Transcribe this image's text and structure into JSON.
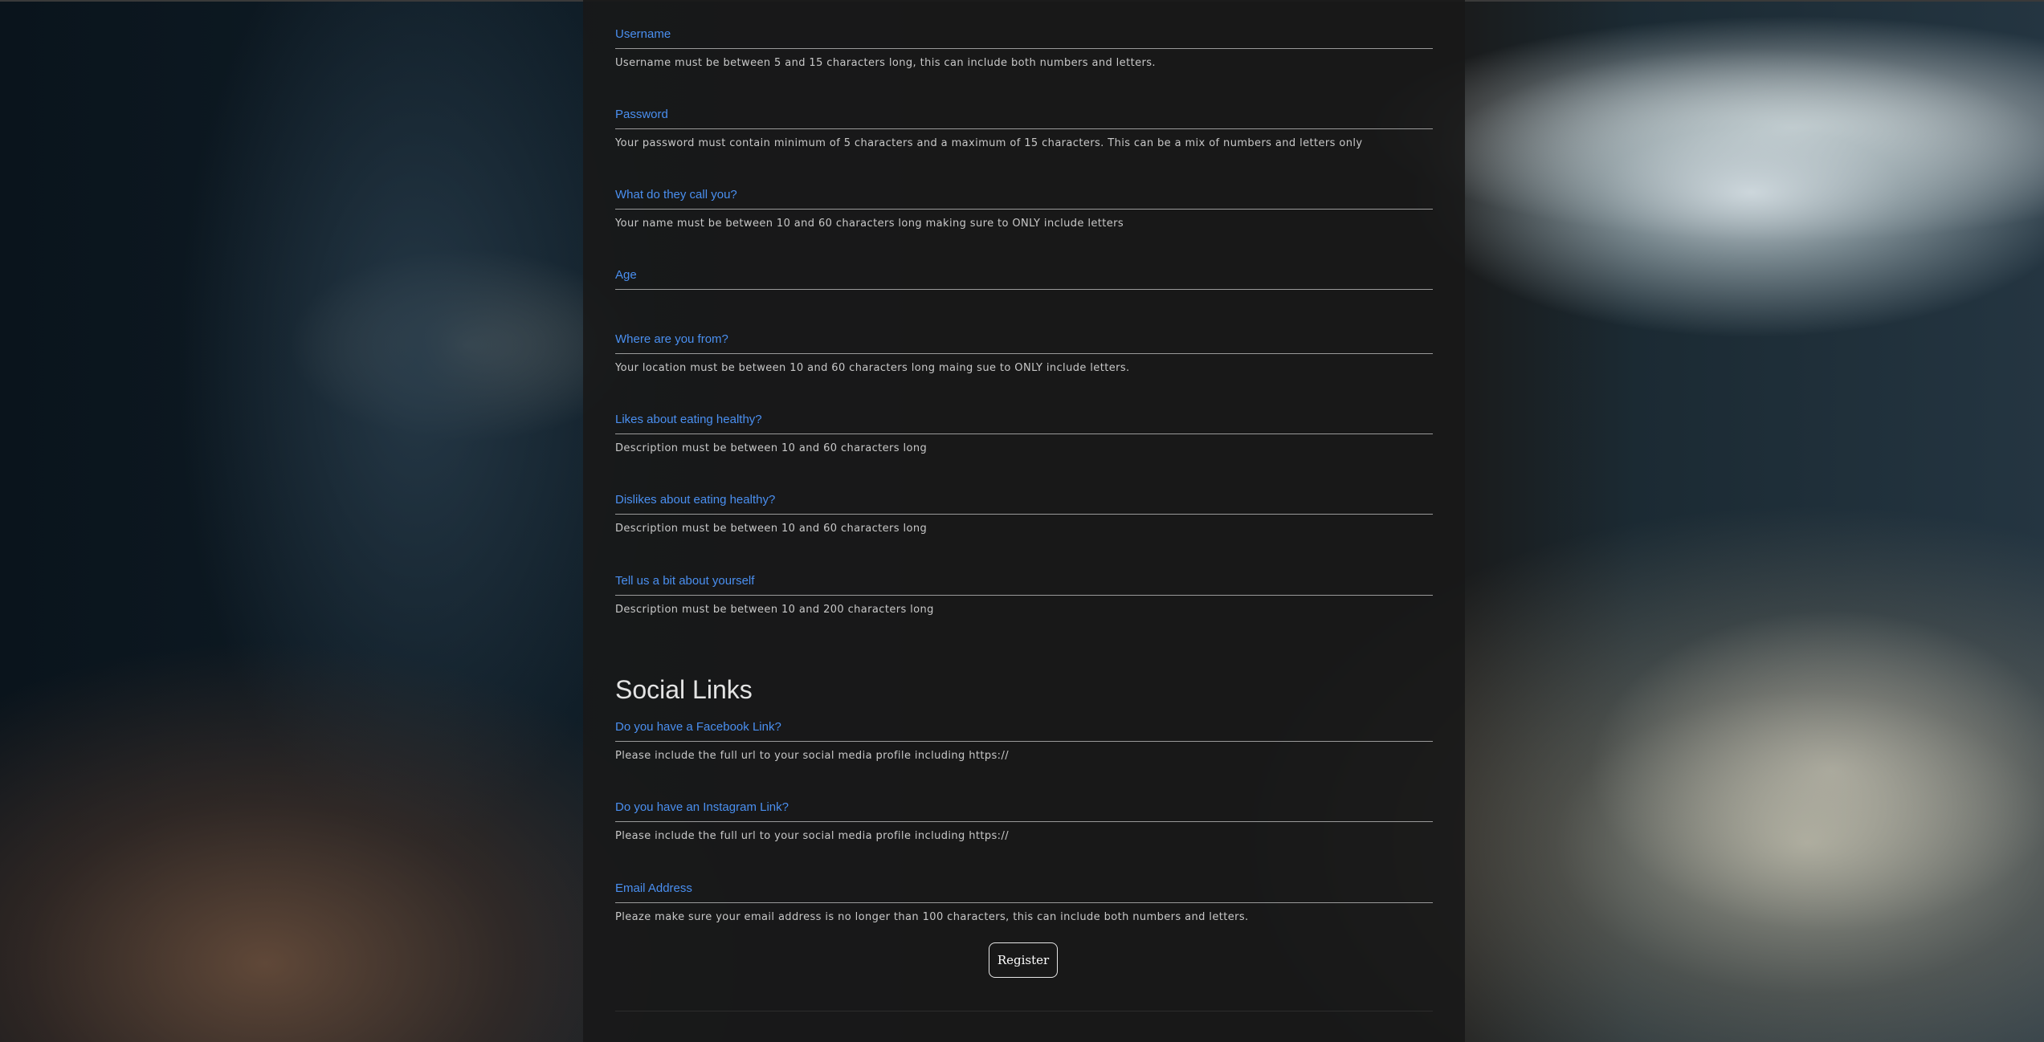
{
  "form": {
    "fields": [
      {
        "label": "Username",
        "help": "Username must be between 5 and 15 characters long, this can include both numbers and letters."
      },
      {
        "label": "Password",
        "help": "Your password must contain minimum of 5 characters and a maximum of 15 characters. This can be a mix of numbers and letters only"
      },
      {
        "label": "What do they call you?",
        "help": "Your name must be between 10 and 60 characters long making sure to ONLY include letters"
      },
      {
        "label": "Age",
        "help": ""
      },
      {
        "label": "Where are you from?",
        "help": "Your location must be between 10 and 60 characters long maing sue to ONLY include letters."
      },
      {
        "label": "Likes about eating healthy?",
        "help": "Description must be between 10 and 60 characters long"
      },
      {
        "label": "Dislikes about eating healthy?",
        "help": "Description must be between 10 and 60 characters long"
      },
      {
        "label": "Tell us a bit about yourself",
        "help": "Description must be between 10 and 200 characters long"
      }
    ],
    "social_heading": "Social Links",
    "social_fields": [
      {
        "label": "Do you have a Facebook Link?",
        "help": "Please include the full url to your social media profile including https://"
      },
      {
        "label": "Do you have an Instagram Link?",
        "help": "Please include the full url to your social media profile including https://"
      },
      {
        "label": "Email Address",
        "help": "Pleaze make sure your email address is no longer than 100 characters, this can include both numbers and letters."
      }
    ],
    "register_label": "Register"
  }
}
